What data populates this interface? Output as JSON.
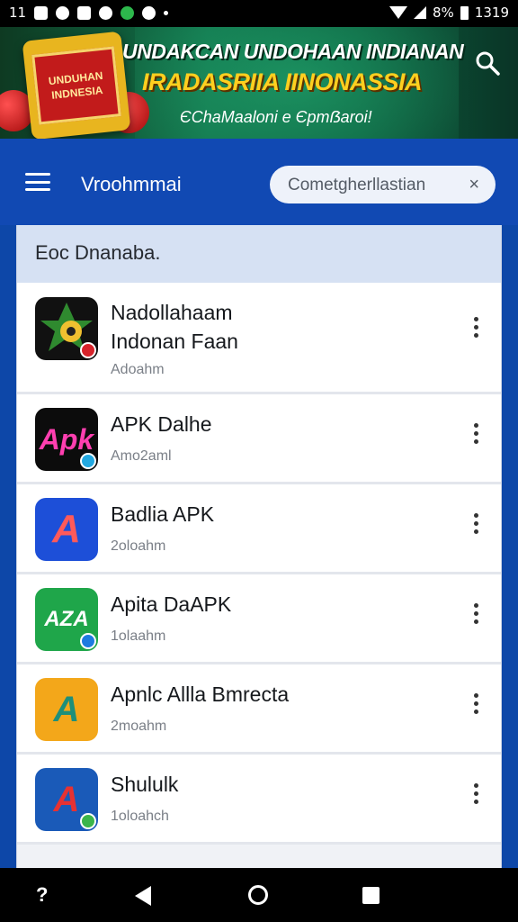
{
  "status_bar": {
    "left_text": "11",
    "battery_text": "8%",
    "time": "1319"
  },
  "banner": {
    "emblem_text_1": "UNDUHAN",
    "emblem_text_2": "INDNESIA",
    "title": "UNDAKCAN UNDOHAAN INDIANAN",
    "subtitle": "IRADASRIIA IINONASSIA",
    "tagline": "ЄChaMaaloni e Єpmẞaroi!"
  },
  "toolbar": {
    "title": "Vroohmmai",
    "search_value": "Cometgherllastian",
    "clear_glyph": "×"
  },
  "list": {
    "header": "Eoc Dnanaba.",
    "apps": [
      {
        "name_line1": "Nadollahaam",
        "name_line2": "Indonan Faan",
        "meta": "Adoahm",
        "icon_text": "",
        "icon_bg": "#111111",
        "badge": "#d6232a"
      },
      {
        "name_line1": "APK Dalhe",
        "name_line2": "",
        "meta": "Amo2aml",
        "icon_text": "Apk",
        "icon_bg": "#0c0c0c",
        "badge": "#23a9e1"
      },
      {
        "name_line1": "Badlia APK",
        "name_line2": "",
        "meta": "2oloahm",
        "icon_text": "A",
        "icon_bg": "#1d4fd8",
        "badge": ""
      },
      {
        "name_line1": "Apita DaAPK",
        "name_line2": "",
        "meta": "1olaahm",
        "icon_text": "AZA",
        "icon_bg": "#1fa64a",
        "badge": "#1e7be0"
      },
      {
        "name_line1": "Apnlc Allla Bmrecta",
        "name_line2": "",
        "meta": "2moahm",
        "icon_text": "A",
        "icon_bg": "#f3a71a",
        "badge": ""
      },
      {
        "name_line1": "Shululk",
        "name_line2": "",
        "meta": "1oloahch",
        "icon_text": "A",
        "icon_bg": "#1a5ab8",
        "badge": "#3bb54a"
      }
    ]
  },
  "nav_bar": {
    "help_glyph": "?"
  }
}
